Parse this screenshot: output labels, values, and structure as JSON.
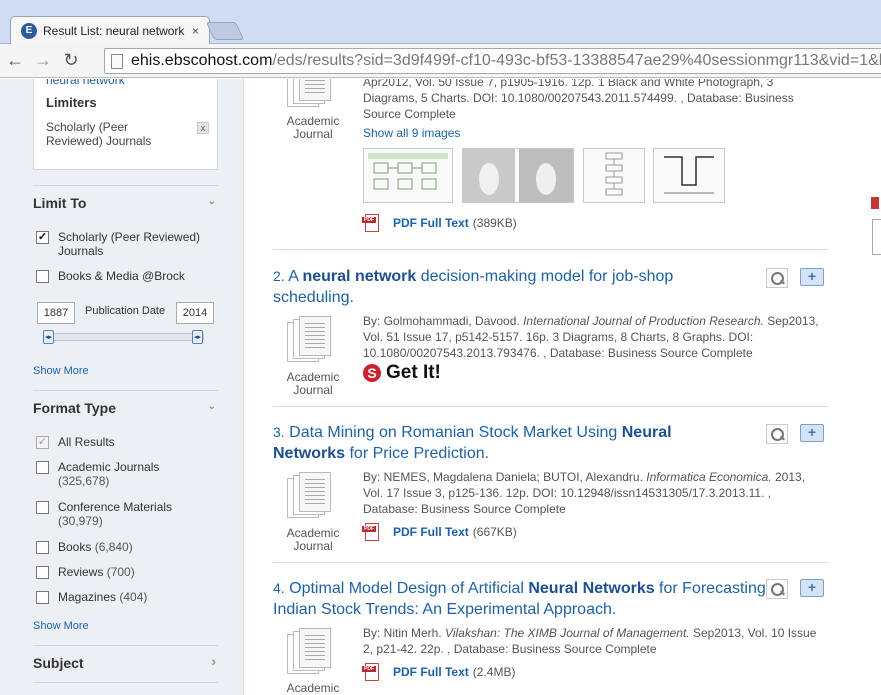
{
  "browser": {
    "tab_title": "Result List: neural network",
    "tab_close": "×",
    "favicon_letter": "E",
    "url_host": "ehis.ebscohost.com",
    "url_rest": "/eds/results?sid=3d9f499f-cf10-493c-bf53-13388547ae29%40sessionmgr113&vid=1&h",
    "back_icon": "←",
    "forward_icon": "→",
    "reload_icon": "↻"
  },
  "sidebar": {
    "top_link": "neural network",
    "limiters_title": "Limiters",
    "limiter_item": "Scholarly (Peer Reviewed) Journals",
    "limiter_remove": "x",
    "limit_to": {
      "heading": "Limit To",
      "options": [
        {
          "label": "Scholarly (Peer Reviewed) Journals",
          "checked": true
        },
        {
          "label": "Books & Media @Brock",
          "checked": false
        }
      ],
      "date_from": "1887",
      "date_to": "2014",
      "date_label": "Publication Date",
      "show_more": "Show More"
    },
    "format_type": {
      "heading": "Format Type",
      "options": [
        {
          "label": "All Results",
          "count": "",
          "checked": true
        },
        {
          "label": "Academic Journals",
          "count": "(325,678)",
          "checked": false
        },
        {
          "label": "Conference Materials",
          "count": "(30,979)",
          "checked": false
        },
        {
          "label": "Books",
          "count": "(6,840)",
          "checked": false
        },
        {
          "label": "Reviews",
          "count": "(700)",
          "checked": false
        },
        {
          "label": "Magazines",
          "count": "(404)",
          "checked": false
        }
      ],
      "show_more": "Show More"
    },
    "subject_heading": "Subject",
    "chevron_down": "⌄",
    "chevron_right": "›"
  },
  "results": {
    "r1": {
      "meta_line1": "Apr2012, Vol. 50 Issue 7, p1905-1916. 12p. 1 Black and White Photograph, 3",
      "meta_line2": "Diagrams, 5 Charts. DOI: 10.1080/00207543.2011.574499. , Database: Business",
      "meta_line3": "Source Complete",
      "type": "Academic Journal",
      "show_images": "Show all 9 images",
      "pdf_label": "PDF Full Text",
      "pdf_size": "(389KB)"
    },
    "r2": {
      "number": "2.",
      "title_pre": "A ",
      "title_bold": "neural network",
      "title_post": " decision-making model for job-shop scheduling.",
      "by": "By: Golmohammadi, Davood.",
      "source": "International Journal of Production Research.",
      "details": "Sep2013, Vol. 51 Issue 17, p5142-5157. 16p. 3 Diagrams, 8 Charts, 8 Graphs. DOI: 10.1080/00207543.2013.793476. , Database: Business Source Complete",
      "type": "Academic Journal",
      "getit": "Get It!",
      "getit_logo": "S"
    },
    "r3": {
      "number": "3.",
      "title_pre": "Data Mining on Romanian Stock Market Using ",
      "title_bold": "Neural Networks",
      "title_post": " for Price Prediction.",
      "by": "By: NEMES, Magdalena Daniela; BUTOI, Alexandru.",
      "source": "Informatica Economica.",
      "details": "2013, Vol. 17 Issue 3, p125-136. 12p. DOI: 10.12948/issn14531305/17.3.2013.11. , Database: Business Source Complete",
      "type": "Academic Journal",
      "pdf_label": "PDF Full Text",
      "pdf_size": "(667KB)"
    },
    "r4": {
      "number": "4.",
      "title_pre": "Optimal Model Design of Artificial ",
      "title_bold": "Neural Networks",
      "title_post": " for Forecasting Indian Stock Trends: An Experimental Approach.",
      "by": "By: Nitin Merh.",
      "source": "Vilakshan: The XIMB Journal of Management.",
      "details": "Sep2013, Vol. 10 Issue 2, p21-42. 22p. , Database: Business Source Complete",
      "type": "Academic",
      "pdf_label": "PDF Full Text",
      "pdf_size": "(2.4MB)"
    },
    "pdf_badge": "PDF",
    "folder_plus": "+"
  }
}
